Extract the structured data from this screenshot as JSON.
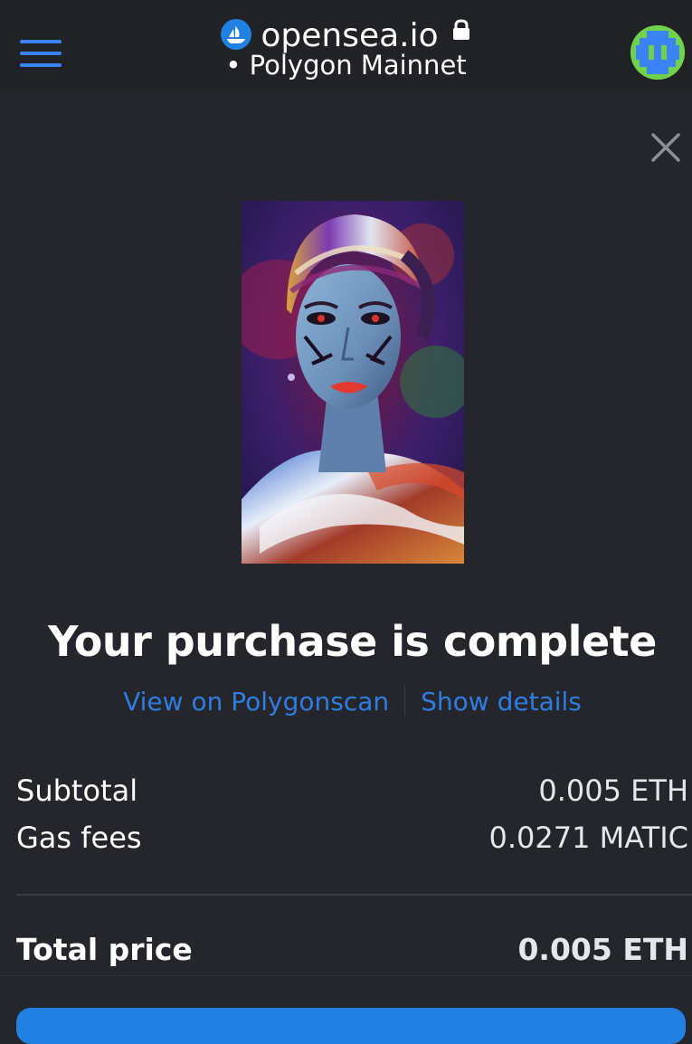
{
  "browser": {
    "domain": "opensea.io",
    "network": "• Polygon Mainnet",
    "menu_icon": "hamburger-menu-icon",
    "lock_icon": "lock-icon",
    "site_icon": "opensea-logo-icon",
    "avatar_icon": "pixel-avatar-icon"
  },
  "modal": {
    "close_icon": "close-icon",
    "title": "Your purchase is complete",
    "links": {
      "explorer": "View on Polygonscan",
      "details": "Show details"
    },
    "summary": {
      "subtotal_label": "Subtotal",
      "subtotal_value": "0.005 ETH",
      "gas_label": "Gas fees",
      "gas_value": "0.0271 MATIC",
      "total_label": "Total price",
      "total_value": "0.005 ETH"
    }
  },
  "colors": {
    "background": "#24262b",
    "topbar": "#202226",
    "accent": "#2081e2",
    "link": "#2e7de0",
    "text": "#ffffff"
  }
}
